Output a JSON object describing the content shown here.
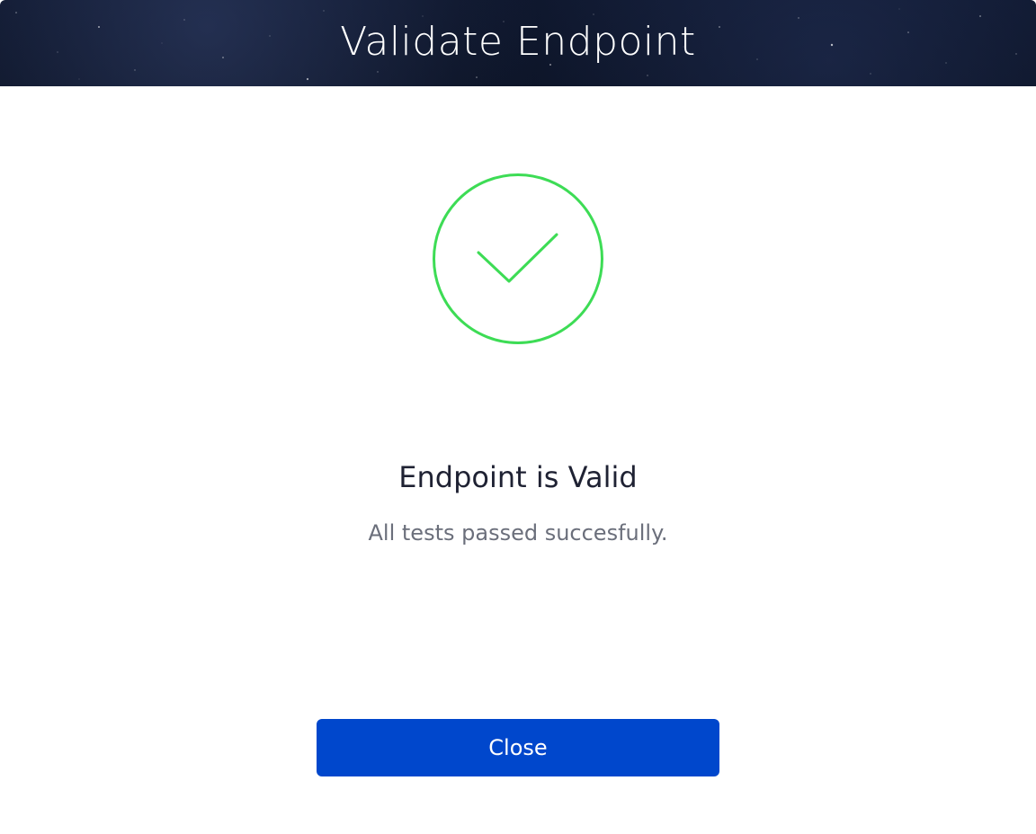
{
  "dialog": {
    "title": "Validate Endpoint",
    "status_icon": "checkmark-circle-icon",
    "status_heading": "Endpoint is Valid",
    "status_message": "All tests passed succesfully.",
    "close_label": "Close"
  },
  "colors": {
    "success": "#3ddc55",
    "primary_button": "#0047cc",
    "header_background": "#0c1428"
  }
}
